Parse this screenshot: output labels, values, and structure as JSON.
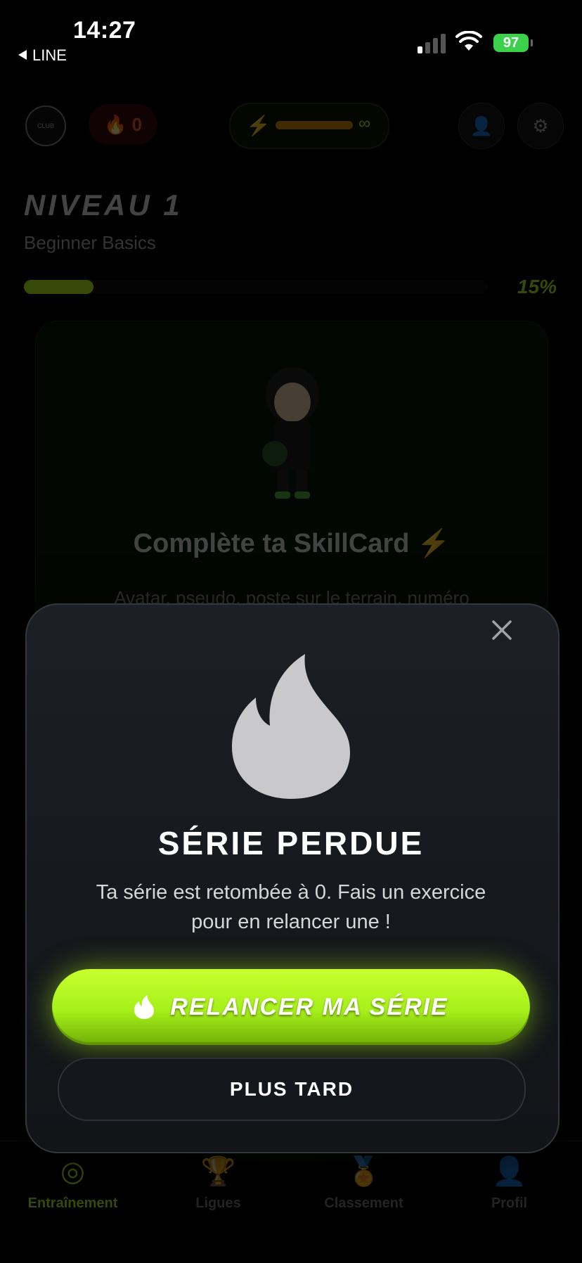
{
  "status_bar": {
    "time": "14:27",
    "back_app": "LINE",
    "battery": "97"
  },
  "header": {
    "streak_count": "0"
  },
  "level": {
    "title": "NIVEAU 1",
    "subtitle": "Beginner Basics",
    "progress_percent": 15,
    "progress_label": "15%"
  },
  "skill_card": {
    "title": "Complète ta SkillCard ⚡",
    "description": "Avatar, pseudo, poste sur le terrain, numéro"
  },
  "tabs": [
    {
      "label": "Entraînement",
      "icon": "target-icon",
      "active": true
    },
    {
      "label": "Ligues",
      "icon": "trophy-icon",
      "active": false
    },
    {
      "label": "Classement",
      "icon": "medal-icon",
      "active": false
    },
    {
      "label": "Profil",
      "icon": "person-icon",
      "active": false
    }
  ],
  "modal": {
    "title": "SÉRIE PERDUE",
    "text": "Ta série est retombée à 0. Fais un exercice pour en relancer une !",
    "primary_button": "RELANCER MA SÉRIE",
    "secondary_button": "PLUS TARD"
  },
  "colors": {
    "accent": "#b7f21c",
    "modal_bg": "#17191d",
    "streak": "#ff5a2a"
  }
}
